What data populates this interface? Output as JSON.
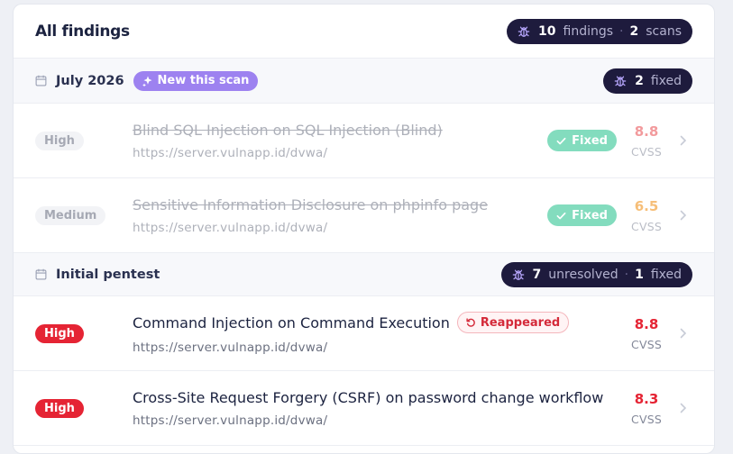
{
  "header": {
    "title": "All findings",
    "summary": {
      "findings_count": "10",
      "findings_label": "findings",
      "scans_count": "2",
      "scans_label": "scans"
    }
  },
  "groups": [
    {
      "title": "July 2026",
      "badge": "New this scan",
      "stats": {
        "fixed_count": "2",
        "fixed_label": "fixed"
      },
      "rows": [
        {
          "severity": "High",
          "title": "Blind SQL Injection on SQL Injection (Blind)",
          "url": "https://server.vulnapp.id/dvwa/",
          "status": "Fixed",
          "score": "8.8",
          "score_label": "CVSS",
          "score_color": "#e8484d"
        },
        {
          "severity": "Medium",
          "title": "Sensitive Information Disclosure on phpinfo page",
          "url": "https://server.vulnapp.id/dvwa/",
          "status": "Fixed",
          "score": "6.5",
          "score_label": "CVSS",
          "score_color": "#f08a0a"
        }
      ]
    },
    {
      "title": "Initial pentest",
      "stats": {
        "unresolved_count": "7",
        "unresolved_label": "unresolved",
        "fixed_count": "1",
        "fixed_label": "fixed"
      },
      "rows": [
        {
          "severity": "High",
          "title": "Command Injection on Command Execution",
          "url": "https://server.vulnapp.id/dvwa/",
          "tag": "Reappeared",
          "score": "8.8",
          "score_label": "CVSS",
          "score_color": "#e52434"
        },
        {
          "severity": "High",
          "title": "Cross-Site Request Forgery (CSRF) on password change workflow",
          "url": "https://server.vulnapp.id/dvwa/",
          "score": "8.3",
          "score_label": "CVSS",
          "score_color": "#e52434"
        }
      ]
    }
  ],
  "colors": {
    "dark_pill": "#1e1b3d",
    "accent_purple": "#9d82f0",
    "fixed_green": "#1ec08a",
    "high_red": "#e52434"
  },
  "icons": {
    "summary": "bug-icon",
    "group": "calendar-icon",
    "new": "sparkle-icon",
    "fixed": "check-icon",
    "reappeared": "refresh-icon",
    "row_action": "chevron-right-icon"
  }
}
